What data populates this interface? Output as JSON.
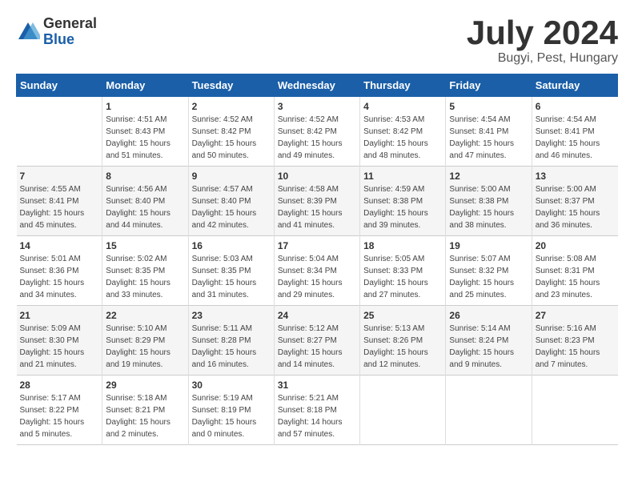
{
  "logo": {
    "general": "General",
    "blue": "Blue"
  },
  "header": {
    "month": "July 2024",
    "location": "Bugyi, Pest, Hungary"
  },
  "weekdays": [
    "Sunday",
    "Monday",
    "Tuesday",
    "Wednesday",
    "Thursday",
    "Friday",
    "Saturday"
  ],
  "weeks": [
    [
      {
        "day": "",
        "sunrise": "",
        "sunset": "",
        "daylight": ""
      },
      {
        "day": "1",
        "sunrise": "Sunrise: 4:51 AM",
        "sunset": "Sunset: 8:43 PM",
        "daylight": "Daylight: 15 hours and 51 minutes."
      },
      {
        "day": "2",
        "sunrise": "Sunrise: 4:52 AM",
        "sunset": "Sunset: 8:42 PM",
        "daylight": "Daylight: 15 hours and 50 minutes."
      },
      {
        "day": "3",
        "sunrise": "Sunrise: 4:52 AM",
        "sunset": "Sunset: 8:42 PM",
        "daylight": "Daylight: 15 hours and 49 minutes."
      },
      {
        "day": "4",
        "sunrise": "Sunrise: 4:53 AM",
        "sunset": "Sunset: 8:42 PM",
        "daylight": "Daylight: 15 hours and 48 minutes."
      },
      {
        "day": "5",
        "sunrise": "Sunrise: 4:54 AM",
        "sunset": "Sunset: 8:41 PM",
        "daylight": "Daylight: 15 hours and 47 minutes."
      },
      {
        "day": "6",
        "sunrise": "Sunrise: 4:54 AM",
        "sunset": "Sunset: 8:41 PM",
        "daylight": "Daylight: 15 hours and 46 minutes."
      }
    ],
    [
      {
        "day": "7",
        "sunrise": "Sunrise: 4:55 AM",
        "sunset": "Sunset: 8:41 PM",
        "daylight": "Daylight: 15 hours and 45 minutes."
      },
      {
        "day": "8",
        "sunrise": "Sunrise: 4:56 AM",
        "sunset": "Sunset: 8:40 PM",
        "daylight": "Daylight: 15 hours and 44 minutes."
      },
      {
        "day": "9",
        "sunrise": "Sunrise: 4:57 AM",
        "sunset": "Sunset: 8:40 PM",
        "daylight": "Daylight: 15 hours and 42 minutes."
      },
      {
        "day": "10",
        "sunrise": "Sunrise: 4:58 AM",
        "sunset": "Sunset: 8:39 PM",
        "daylight": "Daylight: 15 hours and 41 minutes."
      },
      {
        "day": "11",
        "sunrise": "Sunrise: 4:59 AM",
        "sunset": "Sunset: 8:38 PM",
        "daylight": "Daylight: 15 hours and 39 minutes."
      },
      {
        "day": "12",
        "sunrise": "Sunrise: 5:00 AM",
        "sunset": "Sunset: 8:38 PM",
        "daylight": "Daylight: 15 hours and 38 minutes."
      },
      {
        "day": "13",
        "sunrise": "Sunrise: 5:00 AM",
        "sunset": "Sunset: 8:37 PM",
        "daylight": "Daylight: 15 hours and 36 minutes."
      }
    ],
    [
      {
        "day": "14",
        "sunrise": "Sunrise: 5:01 AM",
        "sunset": "Sunset: 8:36 PM",
        "daylight": "Daylight: 15 hours and 34 minutes."
      },
      {
        "day": "15",
        "sunrise": "Sunrise: 5:02 AM",
        "sunset": "Sunset: 8:35 PM",
        "daylight": "Daylight: 15 hours and 33 minutes."
      },
      {
        "day": "16",
        "sunrise": "Sunrise: 5:03 AM",
        "sunset": "Sunset: 8:35 PM",
        "daylight": "Daylight: 15 hours and 31 minutes."
      },
      {
        "day": "17",
        "sunrise": "Sunrise: 5:04 AM",
        "sunset": "Sunset: 8:34 PM",
        "daylight": "Daylight: 15 hours and 29 minutes."
      },
      {
        "day": "18",
        "sunrise": "Sunrise: 5:05 AM",
        "sunset": "Sunset: 8:33 PM",
        "daylight": "Daylight: 15 hours and 27 minutes."
      },
      {
        "day": "19",
        "sunrise": "Sunrise: 5:07 AM",
        "sunset": "Sunset: 8:32 PM",
        "daylight": "Daylight: 15 hours and 25 minutes."
      },
      {
        "day": "20",
        "sunrise": "Sunrise: 5:08 AM",
        "sunset": "Sunset: 8:31 PM",
        "daylight": "Daylight: 15 hours and 23 minutes."
      }
    ],
    [
      {
        "day": "21",
        "sunrise": "Sunrise: 5:09 AM",
        "sunset": "Sunset: 8:30 PM",
        "daylight": "Daylight: 15 hours and 21 minutes."
      },
      {
        "day": "22",
        "sunrise": "Sunrise: 5:10 AM",
        "sunset": "Sunset: 8:29 PM",
        "daylight": "Daylight: 15 hours and 19 minutes."
      },
      {
        "day": "23",
        "sunrise": "Sunrise: 5:11 AM",
        "sunset": "Sunset: 8:28 PM",
        "daylight": "Daylight: 15 hours and 16 minutes."
      },
      {
        "day": "24",
        "sunrise": "Sunrise: 5:12 AM",
        "sunset": "Sunset: 8:27 PM",
        "daylight": "Daylight: 15 hours and 14 minutes."
      },
      {
        "day": "25",
        "sunrise": "Sunrise: 5:13 AM",
        "sunset": "Sunset: 8:26 PM",
        "daylight": "Daylight: 15 hours and 12 minutes."
      },
      {
        "day": "26",
        "sunrise": "Sunrise: 5:14 AM",
        "sunset": "Sunset: 8:24 PM",
        "daylight": "Daylight: 15 hours and 9 minutes."
      },
      {
        "day": "27",
        "sunrise": "Sunrise: 5:16 AM",
        "sunset": "Sunset: 8:23 PM",
        "daylight": "Daylight: 15 hours and 7 minutes."
      }
    ],
    [
      {
        "day": "28",
        "sunrise": "Sunrise: 5:17 AM",
        "sunset": "Sunset: 8:22 PM",
        "daylight": "Daylight: 15 hours and 5 minutes."
      },
      {
        "day": "29",
        "sunrise": "Sunrise: 5:18 AM",
        "sunset": "Sunset: 8:21 PM",
        "daylight": "Daylight: 15 hours and 2 minutes."
      },
      {
        "day": "30",
        "sunrise": "Sunrise: 5:19 AM",
        "sunset": "Sunset: 8:19 PM",
        "daylight": "Daylight: 15 hours and 0 minutes."
      },
      {
        "day": "31",
        "sunrise": "Sunrise: 5:21 AM",
        "sunset": "Sunset: 8:18 PM",
        "daylight": "Daylight: 14 hours and 57 minutes."
      },
      {
        "day": "",
        "sunrise": "",
        "sunset": "",
        "daylight": ""
      },
      {
        "day": "",
        "sunrise": "",
        "sunset": "",
        "daylight": ""
      },
      {
        "day": "",
        "sunrise": "",
        "sunset": "",
        "daylight": ""
      }
    ]
  ]
}
